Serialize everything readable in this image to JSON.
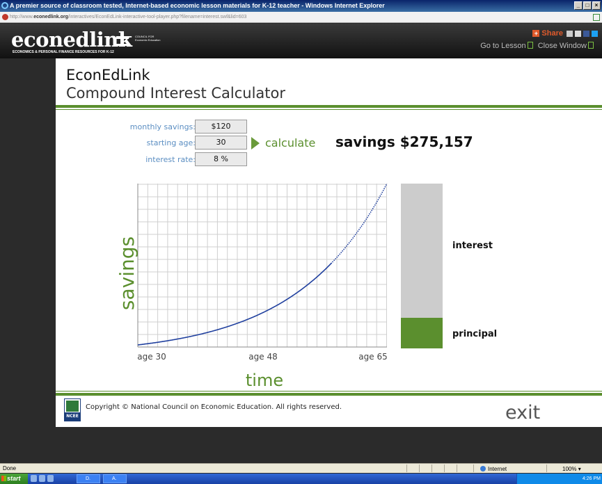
{
  "browser": {
    "title": "A premier source of classroom tested, Internet-based economic lesson materials for K-12 teacher - Windows Internet Explorer",
    "url_prefix": "http://www.",
    "url_domain": "econedlink.org",
    "url_path": "/interactives/EconEdLink-interactive-tool-player.php?filename=interest.swf&lid=603"
  },
  "site": {
    "logo": "econedlink",
    "council": "COUNCIL FOR Economic Education",
    "tagline": "ECONOMICS & PERSONAL FINANCE RESOURCES FOR K-12",
    "share": "Share",
    "go_to_lesson": "Go to Lesson",
    "close_window": "Close Window"
  },
  "app": {
    "title_line1": "EconEdLink",
    "title_line2": "Compound Interest Calculator",
    "inputs": {
      "monthly_savings_label": "monthly savings:",
      "monthly_savings": "$120",
      "starting_age_label": "starting age:",
      "starting_age": "30",
      "interest_rate_label": "interest rate:",
      "interest_rate": "8 %"
    },
    "calculate": "calculate",
    "result": "savings $275,157",
    "bar_labels": {
      "interest": "interest",
      "principal": "principal"
    },
    "copyright": "Copyright © National Council on Economic Education. All rights reserved.",
    "exit": "exit",
    "ncee": "NCEE"
  },
  "chart_data": {
    "type": "line",
    "xlabel": "time",
    "ylabel": "savings",
    "x_tick_labels": [
      "age 30",
      "age 48",
      "age 65"
    ],
    "x": [
      30,
      65
    ],
    "monthly_contribution": 120,
    "annual_rate": 0.08,
    "final_value": 275157,
    "grid": true,
    "series_color": "#1f3f9e",
    "breakdown": {
      "principal_share": 0.18,
      "interest_share": 0.82
    }
  },
  "status": {
    "text": "Done",
    "zone": "Internet",
    "zoom": "100%"
  },
  "taskbar": {
    "start": "start",
    "tasks": [
      "D.",
      "A."
    ],
    "clock": "4:26 PM"
  }
}
